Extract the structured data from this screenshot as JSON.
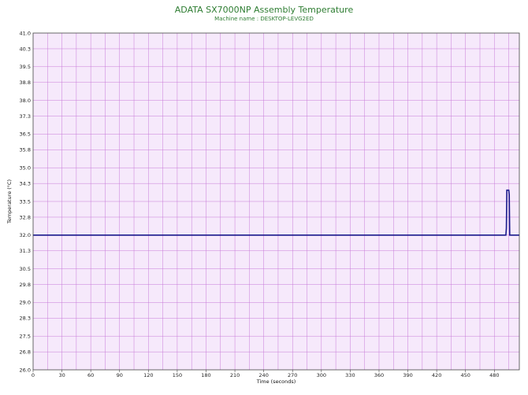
{
  "chart_data": {
    "type": "line",
    "title": "ADATA SX7000NP Assembly Temperature",
    "subtitle": "Machine name : DESKTOP-LEVG2ED",
    "xlabel": "Time (seconds)",
    "ylabel": "Temperature (°C)",
    "xlim": [
      0,
      506
    ],
    "ylim": [
      26.0,
      41.0
    ],
    "x_ticks": [
      0,
      30,
      60,
      90,
      120,
      150,
      180,
      210,
      240,
      270,
      300,
      330,
      360,
      390,
      420,
      450,
      480
    ],
    "y_ticks": [
      "26.0",
      "26.8",
      "27.5",
      "28.3",
      "29.0",
      "29.8",
      "30.5",
      "31.3",
      "32.0",
      "32.8",
      "33.5",
      "34.3",
      "35.0",
      "35.8",
      "36.5",
      "37.3",
      "38.0",
      "38.8",
      "39.5",
      "40.3",
      "41.0"
    ],
    "grid": true,
    "colors": {
      "plot_bg": "#f6e9fb",
      "grid": "#c87ad8",
      "line": "#1a1a8c",
      "title": "#2e7d32"
    },
    "series": [
      {
        "x": [
          0,
          492,
          492.5,
          493,
          495,
          495.5,
          496,
          506
        ],
        "y": [
          32.0,
          32.0,
          32.3,
          34.0,
          34.0,
          33.8,
          32.0,
          32.0
        ]
      }
    ]
  }
}
